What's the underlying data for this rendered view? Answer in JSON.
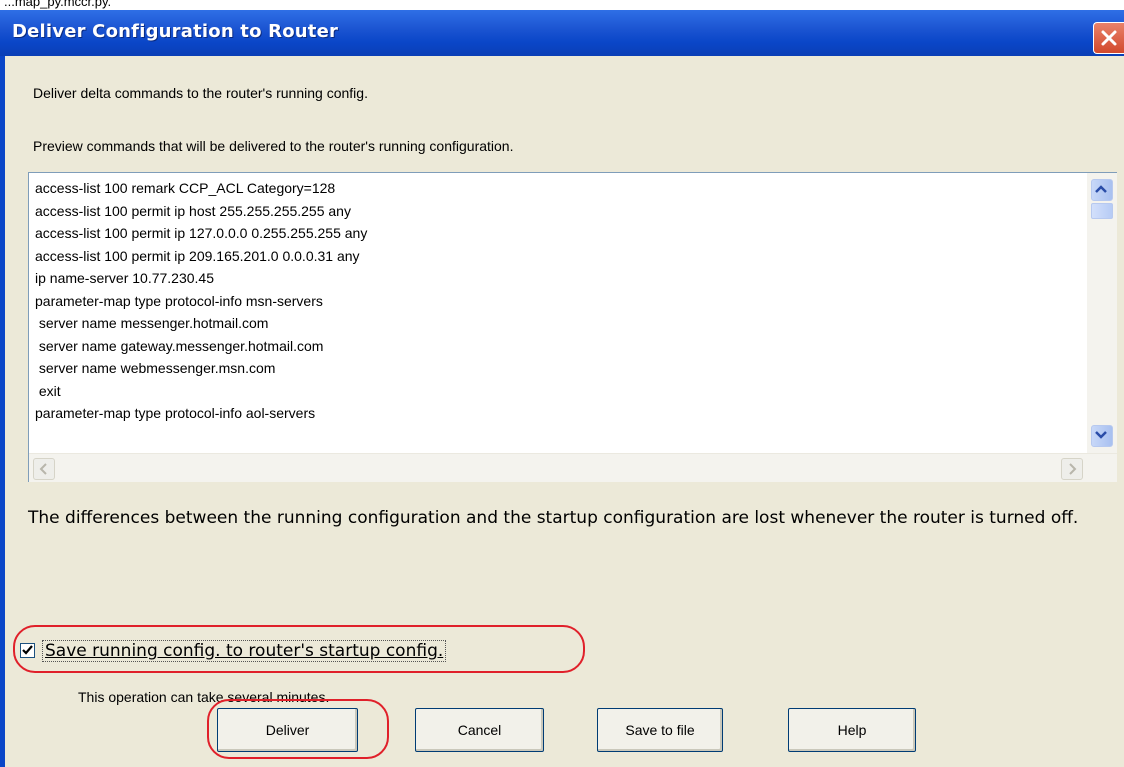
{
  "top_crop_text": "...map_py.mccr.py.",
  "dialog": {
    "title": "Deliver Configuration to Router",
    "description": "Deliver delta commands to the router's running config.",
    "preview_label": "Preview commands that will be delivered to the router's running configuration.",
    "commands": [
      "access-list 100 remark CCP_ACL Category=128",
      "access-list 100 permit ip host 255.255.255.255 any",
      "access-list 100 permit ip 127.0.0.0 0.255.255.255 any",
      "access-list 100 permit ip 209.165.201.0 0.0.0.31 any",
      "ip name-server 10.77.230.45",
      "parameter-map type protocol-info msn-servers",
      " server name messenger.hotmail.com",
      " server name gateway.messenger.hotmail.com",
      " server name webmessenger.msn.com",
      " exit",
      "parameter-map type protocol-info aol-servers"
    ],
    "difference_note": "The differences between the running configuration and the startup configuration are lost whenever the router is turned off.",
    "save_checkbox": {
      "label": "Save running config. to router's startup config.",
      "checked": true
    },
    "operation_note": "This operation can take several minutes.",
    "buttons": {
      "deliver": "Deliver",
      "cancel": "Cancel",
      "save_to_file": "Save to file",
      "help": "Help"
    }
  },
  "colors": {
    "titlebar": "#0a46c8",
    "dialog_bg": "#ECE9D8",
    "highlight": "#e0202a"
  }
}
